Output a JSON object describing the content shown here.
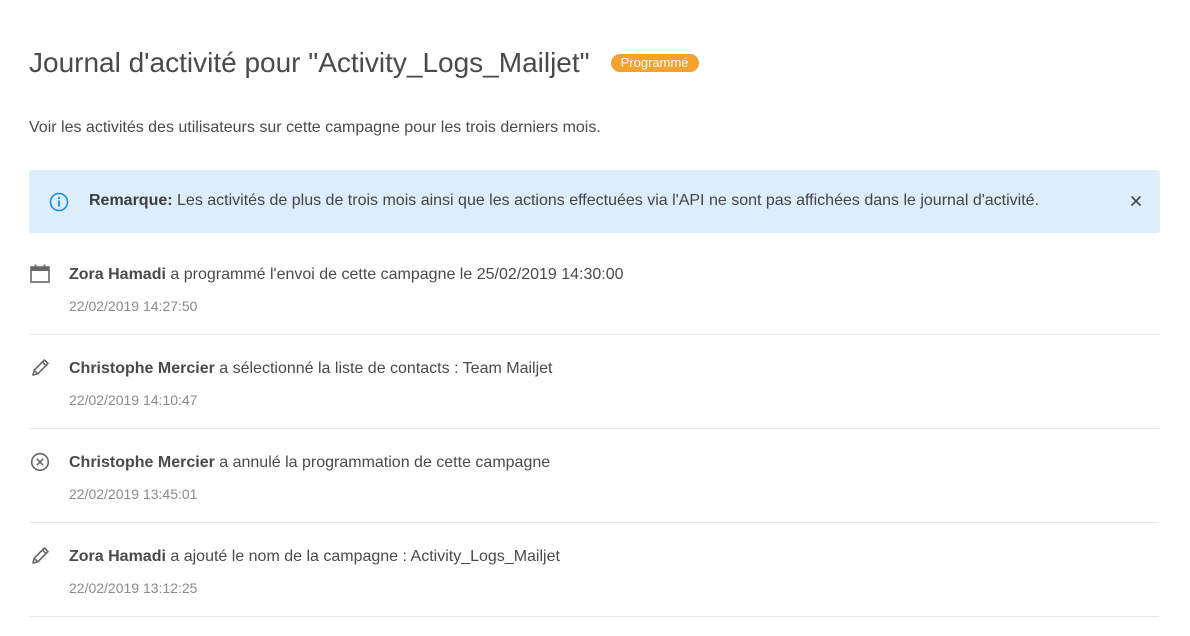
{
  "header": {
    "title": "Journal d'activité pour \"Activity_Logs_Mailjet\"",
    "status_badge": "Programmé",
    "status_color": "#f4a12f"
  },
  "subtitle": "Voir les activités des utilisateurs sur cette campagne pour les trois derniers mois.",
  "notice": {
    "icon": "info-icon",
    "label": "Remarque:",
    "text": " Les activités de plus de trois mois ainsi que les actions effectuées via l'API ne sont pas affichées dans le journal d'activité.",
    "close_icon": "close-icon",
    "background": "#dcedfb"
  },
  "activities": [
    {
      "icon": "calendar-icon",
      "user": "Zora Hamadi",
      "action": " a programmé l'envoi de cette campagne le 25/02/2019 14:30:00",
      "timestamp": "22/02/2019 14:27:50"
    },
    {
      "icon": "pencil-icon",
      "user": "Christophe Mercier",
      "action": " a sélectionné la liste de contacts : Team Mailjet",
      "timestamp": "22/02/2019 14:10:47"
    },
    {
      "icon": "cancel-circle-icon",
      "user": "Christophe Mercier",
      "action": " a annulé la programmation de cette campagne",
      "timestamp": "22/02/2019 13:45:01"
    },
    {
      "icon": "pencil-icon",
      "user": "Zora Hamadi",
      "action": " a ajouté le nom de la campagne : Activity_Logs_Mailjet",
      "timestamp": "22/02/2019 13:12:25"
    }
  ]
}
